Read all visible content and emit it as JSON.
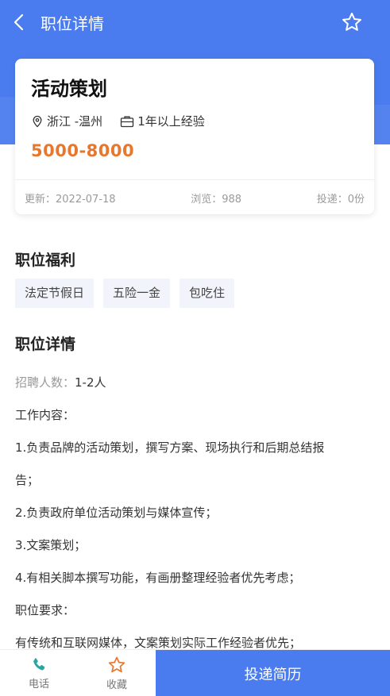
{
  "nav": {
    "title": "职位详情",
    "back_icon": "chevron-left-icon",
    "favorite_icon": "star-outline-icon"
  },
  "job": {
    "title": "活动策划",
    "location": "浙江 -温州",
    "experience": "1年以上经验",
    "salary": "5000-8000",
    "updated": "更新：2022-07-18",
    "views": "浏览：988",
    "applications": "投递：0份"
  },
  "benefits": {
    "title": "职位福利",
    "tags": [
      "法定节假日",
      "五险一金",
      "包吃住"
    ]
  },
  "details": {
    "title": "职位详情",
    "headcount_label": "招聘人数：",
    "headcount_value": "1-2人",
    "lines": [
      "工作内容：",
      "1.负责品牌的活动策划，撰写方案、现场执行和后期总结报",
      "告；",
      "2.负责政府单位活动策划与媒体宣传；",
      "3.文案策划；",
      "4.有相关脚本撰写功能，有画册整理经验者优先考虑；",
      "职位要求：",
      "有传统和互联网媒体，文案策划实际工作经验者优先；"
    ]
  },
  "bottom": {
    "phone_label": "电话",
    "favorite_label": "收藏",
    "apply_label": "投递简历"
  },
  "colors": {
    "primary": "#4a7cf0",
    "salary": "#e8772e",
    "phone_icon": "#2aa6a0",
    "favorite_icon": "#e8772e"
  }
}
